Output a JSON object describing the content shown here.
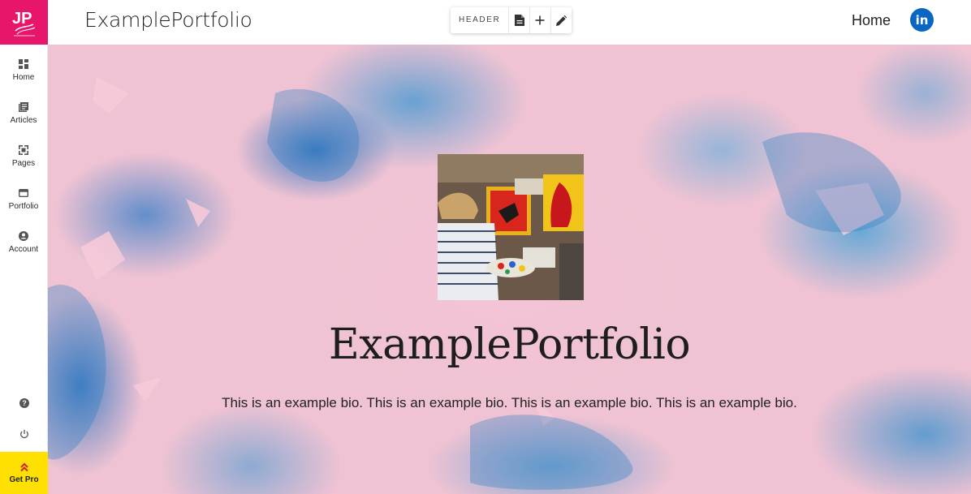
{
  "sidebar": {
    "logo_text": "JP",
    "items": [
      {
        "label": "Home",
        "icon": "dashboard-grid-icon"
      },
      {
        "label": "Articles",
        "icon": "articles-icon"
      },
      {
        "label": "Pages",
        "icon": "pages-icon"
      },
      {
        "label": "Portfolio",
        "icon": "portfolio-icon"
      },
      {
        "label": "Account",
        "icon": "account-icon"
      }
    ],
    "help_icon": "help-icon",
    "power_icon": "power-icon",
    "get_pro_label": "Get Pro"
  },
  "header": {
    "site_title": "ExamplePortfolio",
    "toolbar": {
      "label": "HEADER",
      "buttons": [
        "document-icon",
        "plus-icon",
        "pencil-icon"
      ]
    },
    "nav_home": "Home",
    "social": "linkedin-icon"
  },
  "hero": {
    "title": "ExamplePortfolio",
    "bio": "This is an example bio. This is an example bio. This is an example bio. This is an example bio."
  },
  "colors": {
    "brand": "#e8166b",
    "get_pro": "#ffe000",
    "linkedin": "#0a66c2"
  }
}
